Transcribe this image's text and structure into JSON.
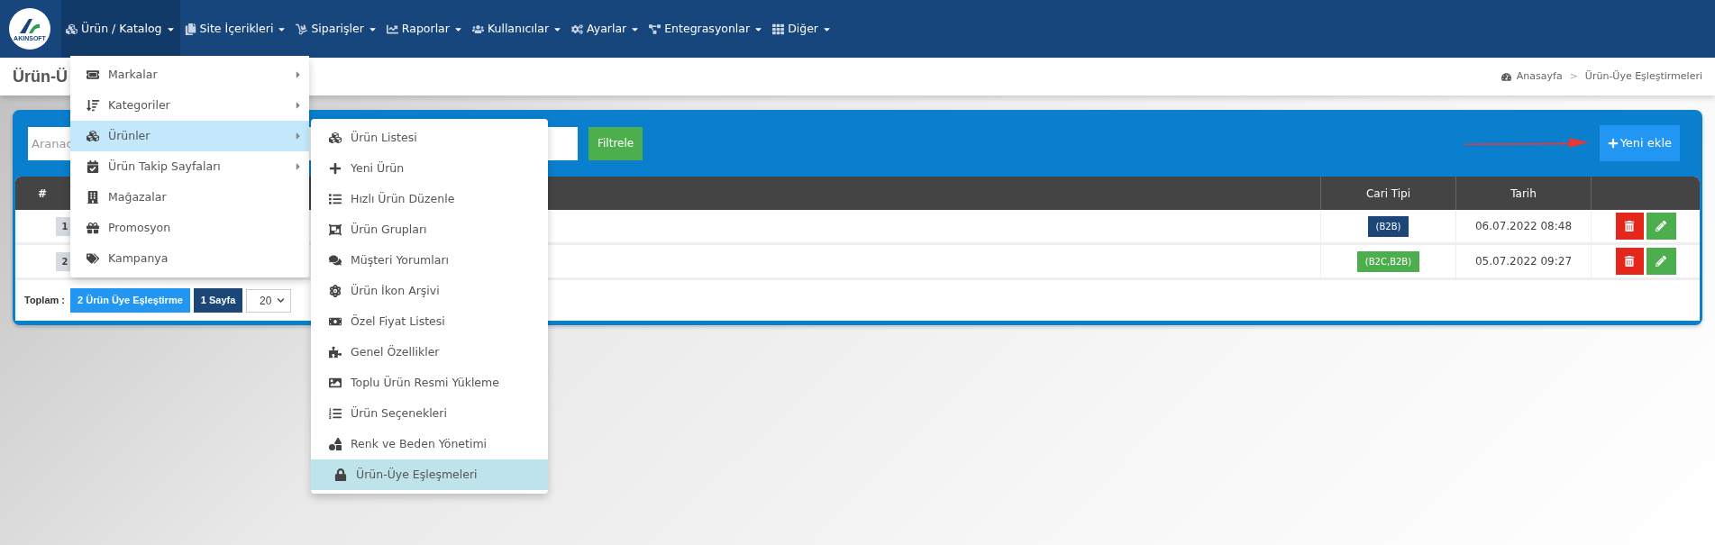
{
  "logo": {
    "text": "AKINSOFT"
  },
  "nav": [
    {
      "label": "Ürün / Katalog",
      "selected": true
    },
    {
      "label": "Site İçerikleri",
      "selected": false
    },
    {
      "label": "Siparişler",
      "selected": false
    },
    {
      "label": "Raporlar",
      "selected": false
    },
    {
      "label": "Kullanıcılar",
      "selected": false
    },
    {
      "label": "Ayarlar",
      "selected": false
    },
    {
      "label": "Entegrasyonlar",
      "selected": false
    },
    {
      "label": "Diğer",
      "selected": false
    }
  ],
  "page_title": "Ürün-Ü",
  "breadcrumb": {
    "home": "Anasayfa",
    "separator": ">",
    "current": "Ürün-Üye Eşleştirmeleri"
  },
  "search": {
    "placeholder": "Aranac"
  },
  "filter_button": "Filtrele",
  "add_button": "Yeni ekle",
  "table": {
    "columns": {
      "number": "#",
      "type": "Cari Tipi",
      "date": "Tarih"
    },
    "rows": [
      {
        "number": "1",
        "type": "(B2B)",
        "color": "#1b4677",
        "date": "06.07.2022 08:48"
      },
      {
        "number": "2",
        "type": "(B2C,B2B)",
        "color": "#4cae4c",
        "date": "05.07.2022 09:27"
      }
    ]
  },
  "footer": {
    "label": "Toplam :",
    "count": "2 Ürün Üye Eşleştirme",
    "pages": "1 Sayfa",
    "page_size": "20"
  },
  "menu": {
    "items": [
      {
        "label": "Markalar",
        "submenu": true,
        "selected": false
      },
      {
        "label": "Kategoriler",
        "submenu": true,
        "selected": false
      },
      {
        "label": "Ürünler",
        "submenu": true,
        "selected": true
      },
      {
        "label": "Ürün Takip Sayfaları",
        "submenu": true,
        "selected": false
      },
      {
        "label": "Mağazalar",
        "submenu": false,
        "selected": false
      },
      {
        "label": "Promosyon",
        "submenu": false,
        "selected": false
      },
      {
        "label": "Kampanya",
        "submenu": false,
        "selected": false
      }
    ]
  },
  "submenu": {
    "items": [
      {
        "label": "Ürün Listesi",
        "selected": false
      },
      {
        "label": "Yeni Ürün",
        "selected": false
      },
      {
        "label": "Hızlı Ürün Düzenle",
        "selected": false
      },
      {
        "label": "Ürün Grupları",
        "selected": false
      },
      {
        "label": "Müşteri Yorumları",
        "selected": false
      },
      {
        "label": "Ürün İkon Arşivi",
        "selected": false
      },
      {
        "label": "Özel Fiyat Listesi",
        "selected": false
      },
      {
        "label": "Genel Özellikler",
        "selected": false
      },
      {
        "label": "Toplu Ürün Resmi Yükleme",
        "selected": false
      },
      {
        "label": "Ürün Seçenekleri",
        "selected": false
      },
      {
        "label": "Renk ve Beden Yönetimi",
        "selected": false
      },
      {
        "label": "Ürün-Üye Eşleşmeleri",
        "selected": true
      }
    ]
  }
}
